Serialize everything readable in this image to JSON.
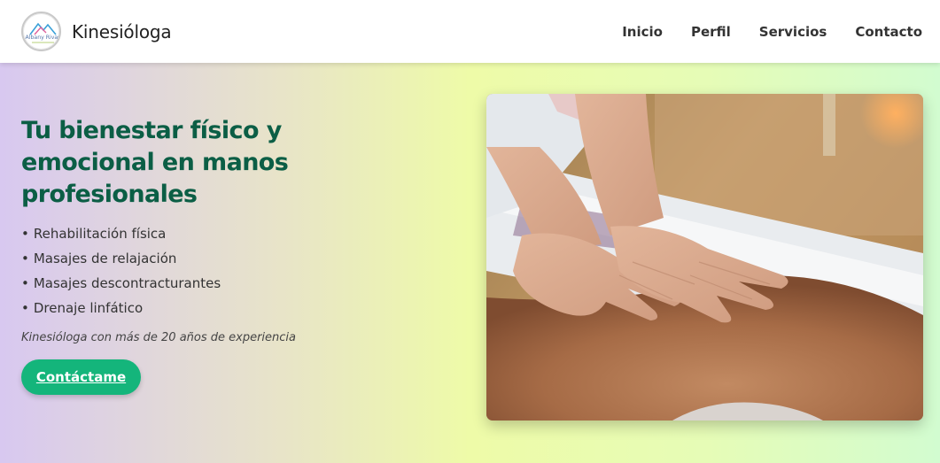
{
  "header": {
    "logo_text": "Albany Rivas",
    "brand_name": "Kinesióloga",
    "nav": [
      {
        "label": "Inicio"
      },
      {
        "label": "Perfil"
      },
      {
        "label": "Servicios"
      },
      {
        "label": "Contacto"
      }
    ]
  },
  "hero": {
    "title": "Tu bienestar físico y emocional en manos profesionales",
    "features": [
      {
        "bullet": "•",
        "text": "Rehabilitación física"
      },
      {
        "bullet": "•",
        "text": "Masajes de relajación"
      },
      {
        "bullet": "•",
        "text": "Masajes descontracturantes"
      },
      {
        "bullet": "•",
        "text": "Drenaje linfático"
      }
    ],
    "tagline": "Kinesióloga con más de 20 años de experiencia",
    "cta_label": "Contáctame"
  },
  "colors": {
    "accent": "#14b57b",
    "title": "#0b5e45"
  }
}
